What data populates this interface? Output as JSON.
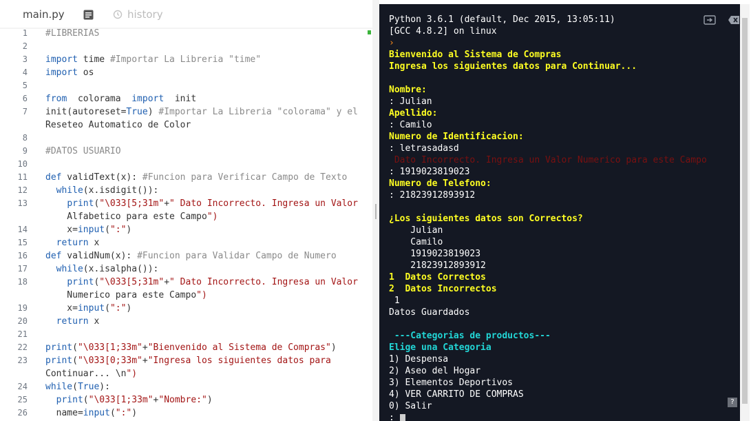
{
  "tabs": {
    "file": "main.py",
    "history": "history"
  },
  "colors": {
    "terminal_bg": "#141823",
    "yellow": "#ffff22",
    "cyan": "#22d6d6",
    "keyword": "#1f5fb0",
    "string": "#a31515",
    "comment": "#8a8a8a"
  },
  "code_lines": [
    {
      "n": "1",
      "t": "#LIBRERIAS"
    },
    {
      "n": "2",
      "t": ""
    },
    {
      "n": "3",
      "t": "import time #Importar La Libreria \"time\""
    },
    {
      "n": "4",
      "t": "import os"
    },
    {
      "n": "5",
      "t": ""
    },
    {
      "n": "6",
      "t": "from  colorama  import  init"
    },
    {
      "n": "7",
      "t": "init(autoreset=True) #Importar La Libreria \"colorama\" y el"
    },
    {
      "n": "",
      "t": "Reseteo Automatico de Color"
    },
    {
      "n": "8",
      "t": ""
    },
    {
      "n": "9",
      "t": "#DATOS USUARIO"
    },
    {
      "n": "10",
      "t": ""
    },
    {
      "n": "11",
      "t": "def validText(x): #Funcion para Verificar Campo de Texto"
    },
    {
      "n": "12",
      "t": "  while(x.isdigit()):"
    },
    {
      "n": "13",
      "t": "    print(\"\\033[5;31m\"+\" Dato Incorrecto. Ingresa un Valor"
    },
    {
      "n": "",
      "t": "    Alfabetico para este Campo\")"
    },
    {
      "n": "14",
      "t": "    x=input(\":\")"
    },
    {
      "n": "15",
      "t": "  return x"
    },
    {
      "n": "16",
      "t": "def validNum(x): #Funcion para Validar Campo de Numero"
    },
    {
      "n": "17",
      "t": "  while(x.isalpha()):"
    },
    {
      "n": "18",
      "t": "    print(\"\\033[5;31m\"+\" Dato Incorrecto. Ingresa un Valor"
    },
    {
      "n": "",
      "t": "    Numerico para este Campo\")"
    },
    {
      "n": "19",
      "t": "    x=input(\":\")"
    },
    {
      "n": "20",
      "t": "  return x"
    },
    {
      "n": "21",
      "t": ""
    },
    {
      "n": "22",
      "t": "print(\"\\033[1;33m\"+\"Bienvenido al Sistema de Compras\")"
    },
    {
      "n": "23",
      "t": "print(\"\\033[0;33m\"+\"Ingresa los siguientes datos para"
    },
    {
      "n": "",
      "t": "Continuar... \\n\")"
    },
    {
      "n": "24",
      "t": "while(True):"
    },
    {
      "n": "25",
      "t": "  print(\"\\033[1;33m\"+\"Nombre:\")"
    },
    {
      "n": "26",
      "t": "  name=input(\":\")"
    }
  ],
  "terminal_lines": [
    {
      "t": "Python 3.6.1 (default, Dec 2015, 13:05:11)",
      "c": "w"
    },
    {
      "t": "[GCC 4.8.2] on linux",
      "c": "w"
    },
    {
      "t": "›",
      "c": "prompt"
    },
    {
      "t": "Bienvenido al Sistema de Compras",
      "c": "y"
    },
    {
      "t": "Ingresa los siguientes datos para Continuar...",
      "c": "y"
    },
    {
      "t": "",
      "c": "w"
    },
    {
      "t": "Nombre:",
      "c": "y"
    },
    {
      "t": ": Julian",
      "c": "w"
    },
    {
      "t": "Apellido:",
      "c": "y"
    },
    {
      "t": ": Camilo",
      "c": "w"
    },
    {
      "t": "Numero de Identificacion:",
      "c": "y"
    },
    {
      "t": ": letrasadasd",
      "c": "w"
    },
    {
      "t": " Dato Incorrecto. Ingresa un Valor Numerico para este Campo",
      "c": "red"
    },
    {
      "t": ": 1919023819023",
      "c": "w"
    },
    {
      "t": "Numero de Telefono:",
      "c": "y"
    },
    {
      "t": ": 21823912893912",
      "c": "w"
    },
    {
      "t": "",
      "c": "w"
    },
    {
      "t": "¿Los siguientes datos son Correctos?",
      "c": "y"
    },
    {
      "t": "    Julian",
      "c": "w"
    },
    {
      "t": "    Camilo",
      "c": "w"
    },
    {
      "t": "    1919023819023",
      "c": "w"
    },
    {
      "t": "    21823912893912",
      "c": "w"
    },
    {
      "t": "1  Datos Correctos",
      "c": "y"
    },
    {
      "t": "2  Datos Incorrectos",
      "c": "y"
    },
    {
      "t": " 1",
      "c": "w"
    },
    {
      "t": "Datos Guardados",
      "c": "w"
    },
    {
      "t": "",
      "c": "w"
    },
    {
      "t": " ---Categorias de productos---",
      "c": "cy"
    },
    {
      "t": "Elige una Categoria",
      "c": "cy"
    },
    {
      "t": "1) Despensa",
      "c": "w"
    },
    {
      "t": "2) Aseo del Hogar",
      "c": "w"
    },
    {
      "t": "3) Elementos Deportivos",
      "c": "w"
    },
    {
      "t": "4) VER CARRITO DE COMPRAS",
      "c": "w"
    },
    {
      "t": "0) Salir",
      "c": "w"
    },
    {
      "t": ": ",
      "c": "w",
      "cursor": true
    }
  ],
  "help": "?"
}
